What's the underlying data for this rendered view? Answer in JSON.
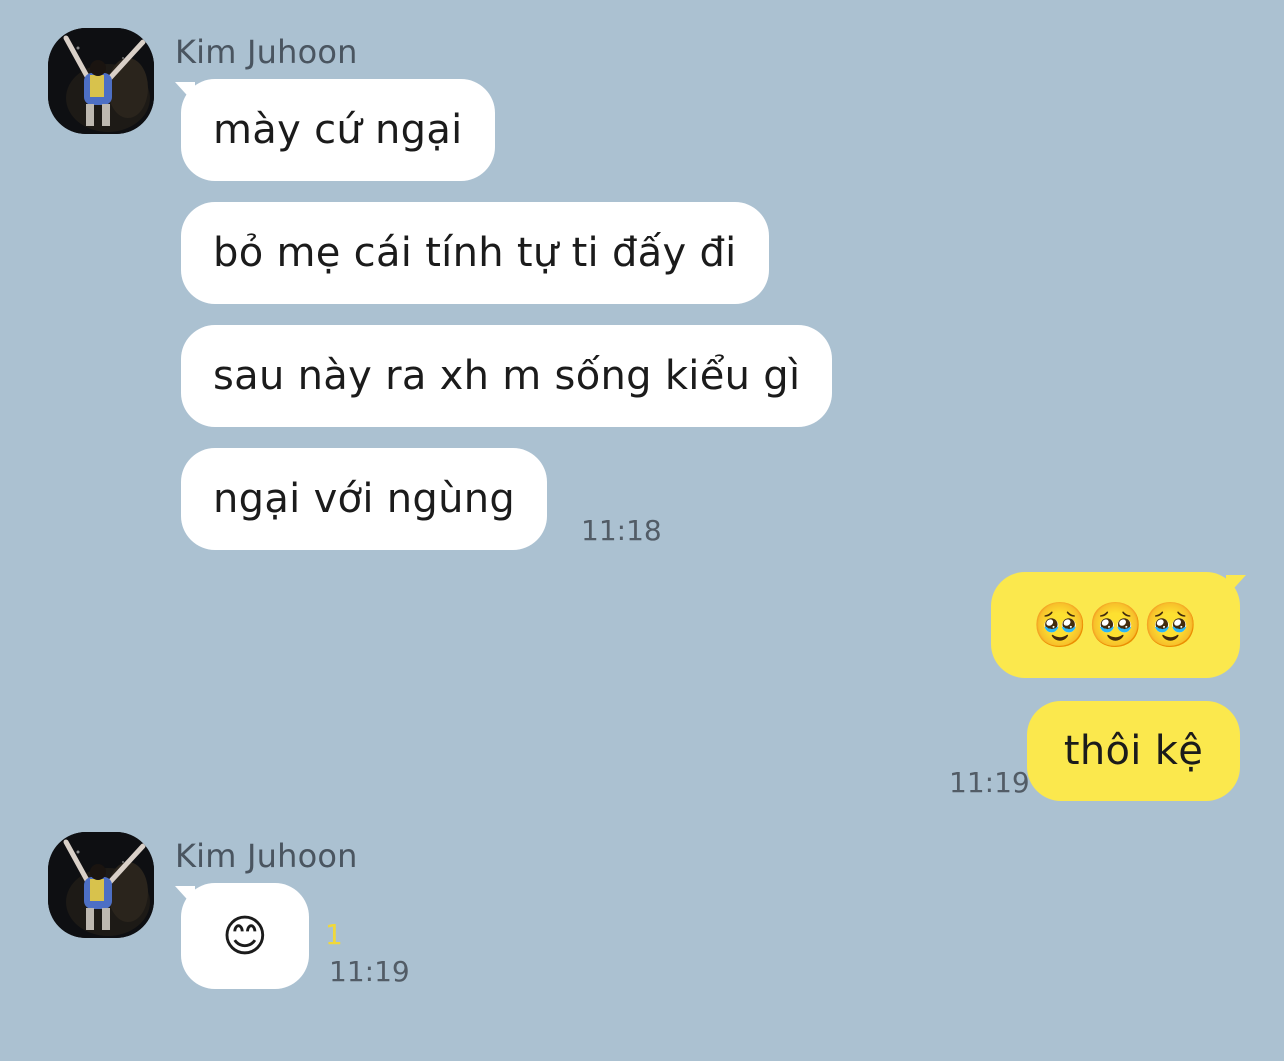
{
  "conversation": {
    "sender_name": "Kim Juhoon",
    "group1": {
      "messages": [
        "mày cứ ngại",
        "bỏ mẹ cái tính tự ti đấy đi",
        "sau này ra xh m sống kiểu gì",
        "ngại với ngùng"
      ],
      "time": "11:18"
    },
    "mine": {
      "emojis": "🥹🥹🥹",
      "text": "thôi kệ",
      "time": "11:19"
    },
    "group2": {
      "emoji": "😊",
      "unread": "1",
      "time": "11:19"
    }
  },
  "colors": {
    "background": "#abc1d1",
    "incoming_bubble": "#ffffff",
    "outgoing_bubble": "#fbe84d",
    "unread_counter": "#f0d83a"
  },
  "icons": {
    "avatar": "profile-photo-person-raising-arms-at-night"
  }
}
